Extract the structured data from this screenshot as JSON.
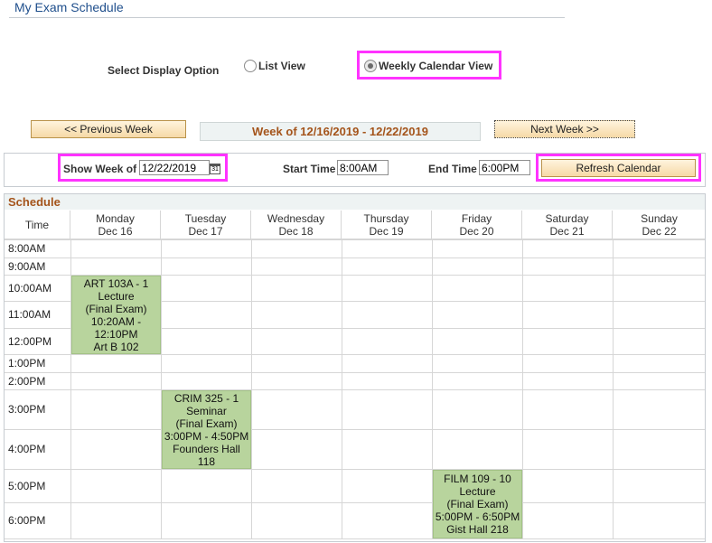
{
  "page": {
    "title": "My Exam Schedule"
  },
  "display_option": {
    "label": "Select Display Option",
    "list_view": "List View",
    "weekly_view": "Weekly Calendar View",
    "selected": "weekly"
  },
  "navigation": {
    "prev_week": "<< Previous Week",
    "week_of": "Week of 12/16/2019 - 12/22/2019",
    "next_week": "Next Week >>"
  },
  "filters": {
    "show_week_label": "Show Week of",
    "show_week_value": "12/22/2019",
    "start_time_label": "Start Time",
    "start_time_value": "8:00AM",
    "end_time_label": "End Time",
    "end_time_value": "6:00PM",
    "refresh": "Refresh Calendar",
    "calendar_icon_text": "31"
  },
  "schedule": {
    "title": "Schedule",
    "time_header": "Time",
    "days": [
      {
        "name": "Monday",
        "date": "Dec 16"
      },
      {
        "name": "Tuesday",
        "date": "Dec 17"
      },
      {
        "name": "Wednesday",
        "date": "Dec 18"
      },
      {
        "name": "Thursday",
        "date": "Dec 19"
      },
      {
        "name": "Friday",
        "date": "Dec 20"
      },
      {
        "name": "Saturday",
        "date": "Dec 21"
      },
      {
        "name": "Sunday",
        "date": "Dec 22"
      }
    ],
    "times": [
      "8:00AM",
      "9:00AM",
      "10:00AM",
      "11:00AM",
      "12:00PM",
      "1:00PM",
      "2:00PM",
      "3:00PM",
      "4:00PM",
      "5:00PM",
      "6:00PM"
    ],
    "events": [
      {
        "day": "Monday",
        "lines": [
          "ART 103A - 1",
          "Lecture",
          "(Final Exam)",
          "10:20AM -",
          "12:10PM",
          "Art B 102"
        ]
      },
      {
        "day": "Tuesday",
        "lines": [
          "CRIM 325 - 1",
          "Seminar",
          "(Final Exam)",
          "3:00PM - 4:50PM",
          "Founders Hall",
          "118"
        ]
      },
      {
        "day": "Friday",
        "lines": [
          "FILM 109 - 10",
          "Lecture",
          "(Final Exam)",
          "5:00PM - 6:50PM",
          "Gist Hall 218"
        ]
      }
    ]
  },
  "colors": {
    "accent": "#a4541b",
    "title": "#1f4f8c",
    "highlight": "#ff33ff",
    "event_bg": "#b8d49d"
  }
}
